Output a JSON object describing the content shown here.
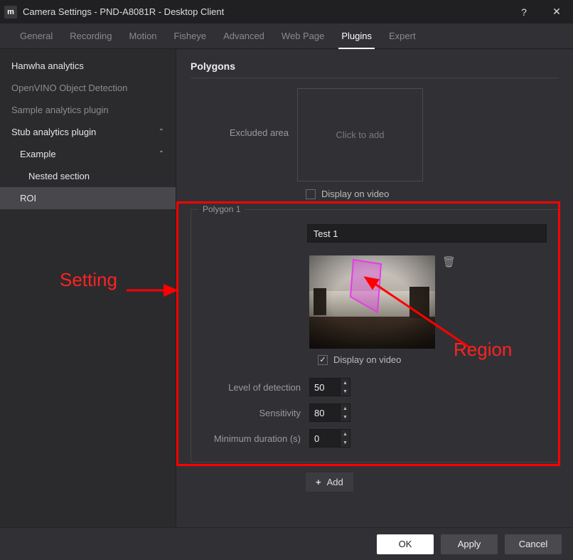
{
  "window": {
    "title": "Camera Settings - PND-A8081R - Desktop Client",
    "app_glyph": "m"
  },
  "tabs": [
    {
      "label": "General",
      "active": false
    },
    {
      "label": "Recording",
      "active": false
    },
    {
      "label": "Motion",
      "active": false
    },
    {
      "label": "Fisheye",
      "active": false
    },
    {
      "label": "Advanced",
      "active": false
    },
    {
      "label": "Web Page",
      "active": false
    },
    {
      "label": "Plugins",
      "active": true
    },
    {
      "label": "Expert",
      "active": false
    }
  ],
  "sidebar": {
    "items": [
      {
        "label": "Hanwha analytics",
        "bright": true
      },
      {
        "label": "OpenVINO Object Detection",
        "bright": false
      },
      {
        "label": "Sample analytics plugin",
        "bright": false
      }
    ],
    "expandable": {
      "label": "Stub analytics plugin"
    },
    "sub": {
      "label": "Example"
    },
    "nested": {
      "label": "Nested section"
    },
    "roi": {
      "label": "ROI"
    }
  },
  "polygons": {
    "title": "Polygons",
    "excluded_label": "Excluded area",
    "click_to_add": "Click to add",
    "display_on_video": "Display on video"
  },
  "polygon1": {
    "legend": "Polygon 1",
    "name_value": "Test 1",
    "display_on_video": "Display on video",
    "level_label": "Level of detection",
    "level_value": "50",
    "sensitivity_label": "Sensitivity",
    "sensitivity_value": "80",
    "min_duration_label": "Minimum duration (s)",
    "min_duration_value": "0",
    "region_color": "#e83ae8"
  },
  "add_button": "Add",
  "footer": {
    "ok": "OK",
    "apply": "Apply",
    "cancel": "Cancel"
  },
  "annotations": {
    "setting": "Setting",
    "region": "Region"
  }
}
